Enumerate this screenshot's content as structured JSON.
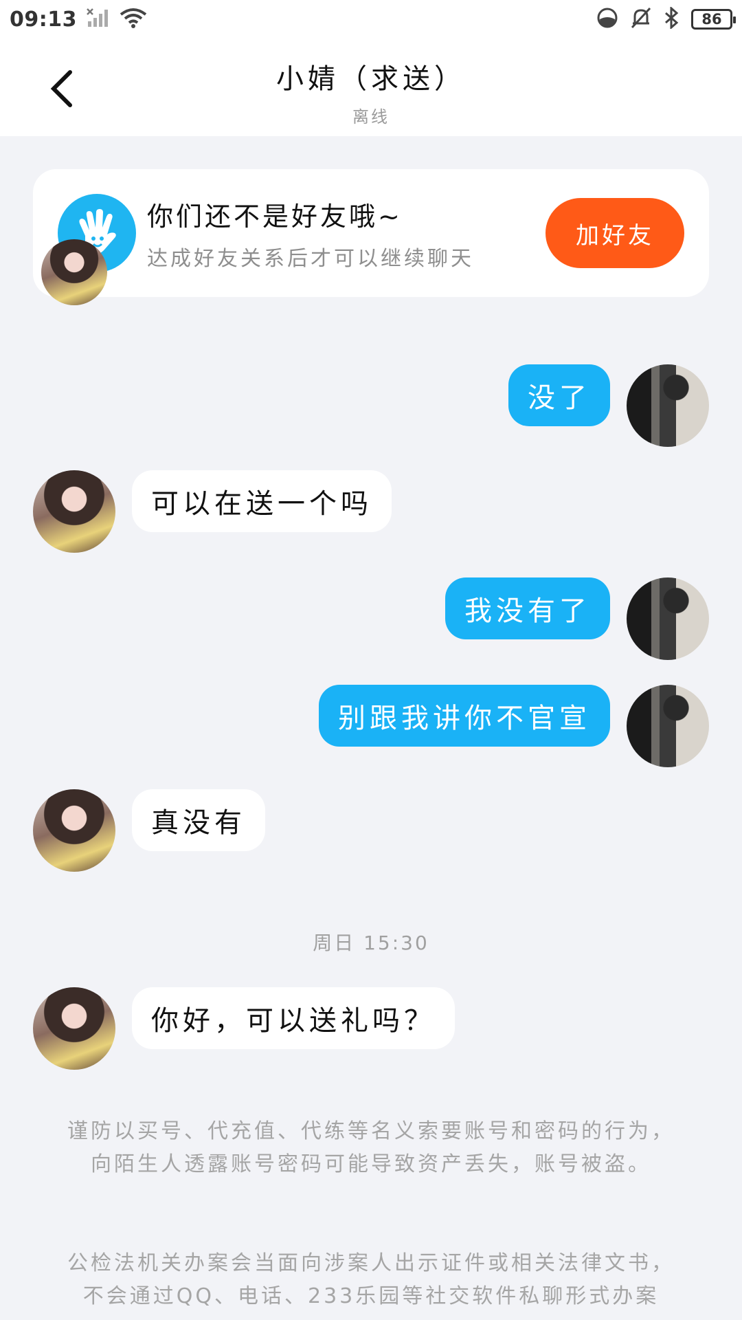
{
  "status_bar": {
    "time": "09:13",
    "battery": "86"
  },
  "header": {
    "title": "小婧（求送）",
    "subtitle": "离线"
  },
  "friend_card": {
    "title": "你们还不是好友哦~",
    "desc": "达成好友关系后才可以继续聊天",
    "button": "加好友"
  },
  "messages": [
    {
      "from": "self",
      "text": "没了"
    },
    {
      "from": "other",
      "text": "可以在送一个吗"
    },
    {
      "from": "self",
      "text": "我没有了"
    },
    {
      "from": "self",
      "text": "别跟我讲你不官宣"
    },
    {
      "from": "other",
      "text": "真没有"
    },
    {
      "from": "other",
      "text": "你好，可以送礼吗？"
    }
  ],
  "timestamp": "周日 15:30",
  "notices": {
    "first": "谨防以买号、代充值、代练等名义索要账号和密码的行为，向陌生人透露账号密码可能导致资产丢失，账号被盗。",
    "second": "公检法机关办案会当面向涉案人出示证件或相关法律文书，不会通过QQ、电话、233乐园等社交软件私聊形式办案"
  },
  "colors": {
    "accent_blue": "#1ab2f6",
    "add_button": "#ff5a17",
    "background": "#f2f3f7"
  },
  "icons": {
    "back": "chevron-left-icon",
    "hand": "hand-wave-icon",
    "signal": "signal-icon",
    "wifi": "wifi-icon",
    "bell_off": "bell-off-icon",
    "bluetooth": "bluetooth-icon",
    "battery": "battery-icon"
  }
}
